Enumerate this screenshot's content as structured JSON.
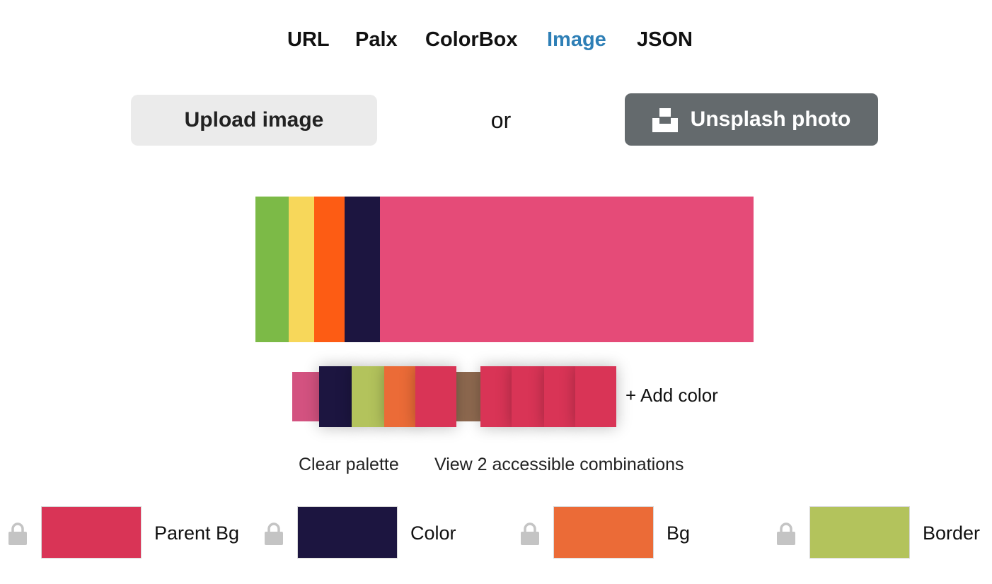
{
  "nav": {
    "items": [
      "URL",
      "Palx",
      "ColorBox",
      "Image",
      "JSON"
    ],
    "active": "Image"
  },
  "upload": {
    "upload_label": "Upload image",
    "or_label": "or",
    "unsplash_label": "Unsplash photo",
    "unsplash_icon": "unsplash-logo-icon"
  },
  "image_colors": [
    "#7cba47",
    "#f7d75a",
    "#fd5c14",
    "#1c1540",
    "#e54b78"
  ],
  "palette": {
    "swatches": [
      "#d35280",
      "#1c1540",
      "#b3c35c",
      "#eb6b37",
      "#d93456",
      "#8f6a50",
      "#d93456",
      "#d93456",
      "#d93456",
      "#d93456"
    ],
    "add_label": "+ Add color"
  },
  "actions": {
    "clear_label": "Clear palette",
    "combinations_label": "View 2 accessible combinations"
  },
  "roles": [
    {
      "label": "Parent Bg",
      "color": "#d93456",
      "icon": "lock-icon"
    },
    {
      "label": "Color",
      "color": "#1c1540",
      "icon": "lock-icon"
    },
    {
      "label": "Bg",
      "color": "#eb6b37",
      "icon": "lock-icon"
    },
    {
      "label": "Border",
      "color": "#b3c35c",
      "icon": "lock-icon"
    }
  ]
}
